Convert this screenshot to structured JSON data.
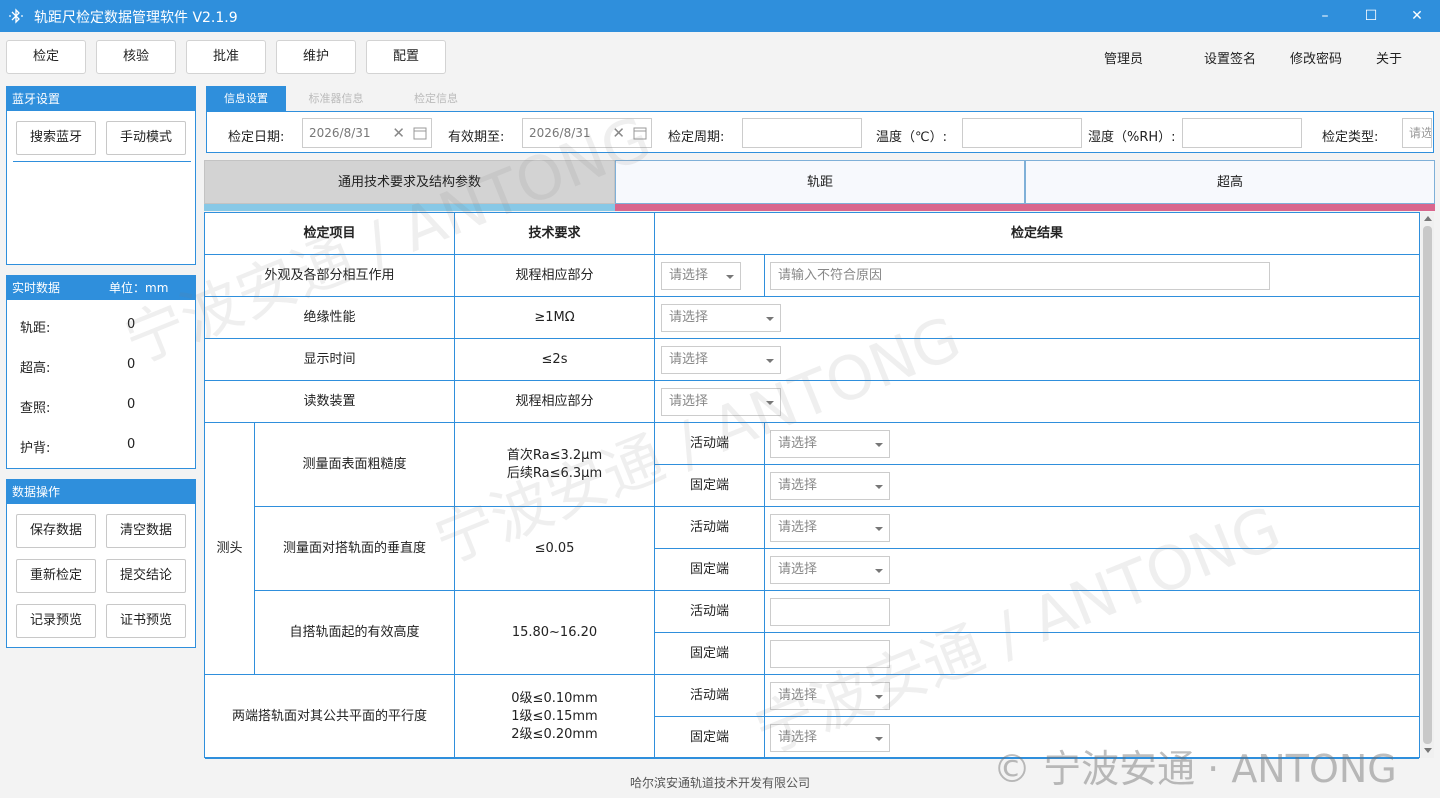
{
  "window": {
    "title": "轨距尺检定数据管理软件 V2.1.9"
  },
  "toolbar": {
    "buttons": [
      "检定",
      "核验",
      "批准",
      "维护",
      "配置"
    ],
    "links": [
      "管理员",
      "设置签名",
      "修改密码",
      "关于"
    ]
  },
  "bluetooth": {
    "title": "蓝牙设置",
    "search_label": "搜索蓝牙",
    "manual_label": "手动模式"
  },
  "realtime": {
    "title": "实时数据",
    "unit": "单位：mm",
    "rows": [
      {
        "label": "轨距:",
        "value": "0"
      },
      {
        "label": "超高:",
        "value": "0"
      },
      {
        "label": "查照:",
        "value": "0"
      },
      {
        "label": "护背:",
        "value": "0"
      }
    ]
  },
  "dataops": {
    "title": "数据操作",
    "buttons": [
      "保存数据",
      "清空数据",
      "重新检定",
      "提交结论",
      "记录预览",
      "证书预览"
    ]
  },
  "info_tabs": [
    "信息设置",
    "标准器信息",
    "检定信息"
  ],
  "info": {
    "date_label": "检定日期:",
    "date_value": "2026/8/31",
    "valid_label": "有效期至:",
    "valid_value": "2026/8/31",
    "period_label": "检定周期:",
    "temp_label": "温度（℃）:",
    "humid_label": "湿度（%RH）:",
    "type_label": "检定类型:",
    "type_placeholder": "请选择"
  },
  "sections": [
    "通用技术要求及结构参数",
    "轨距",
    "超高"
  ],
  "colors": {
    "accent": "#2f8fdc",
    "tab_bar_1": "#87c8e6",
    "tab_bar_2": "#d9668d"
  },
  "table": {
    "headers": [
      "检定项目",
      "技术要求",
      "检定结果"
    ],
    "select_placeholder": "请选择",
    "reason_placeholder": "请输入不符合原因",
    "rows": [
      {
        "item": "外观及各部分相互作用",
        "req": "规程相应部分"
      },
      {
        "item": "绝缘性能",
        "req": "≥1MΩ"
      },
      {
        "item": "显示时间",
        "req": "≤2s"
      },
      {
        "item": "读数装置",
        "req": "规程相应部分"
      }
    ],
    "group_label": "测头",
    "group_rows": [
      {
        "item": "测量面表面粗糙度",
        "req": "首次Ra≤3.2μm\n后续Ra≤6.3μm"
      },
      {
        "item": "测量面对搭轨面的垂直度",
        "req": "≤0.05"
      },
      {
        "item": "自搭轨面起的有效高度",
        "req": "15.80~16.20"
      }
    ],
    "last_row": {
      "item": "两端搭轨面对其公共平面的平行度",
      "req": "0级≤0.10mm\n1级≤0.15mm\n2级≤0.20mm"
    },
    "sub_active": "活动端",
    "sub_fixed": "固定端"
  },
  "footer": "哈尔滨安通轨道技术开发有限公司",
  "watermark": {
    "text": "宁波安通 / ANTONG",
    "copyright": "© 宁波安通 · ANTONG"
  }
}
